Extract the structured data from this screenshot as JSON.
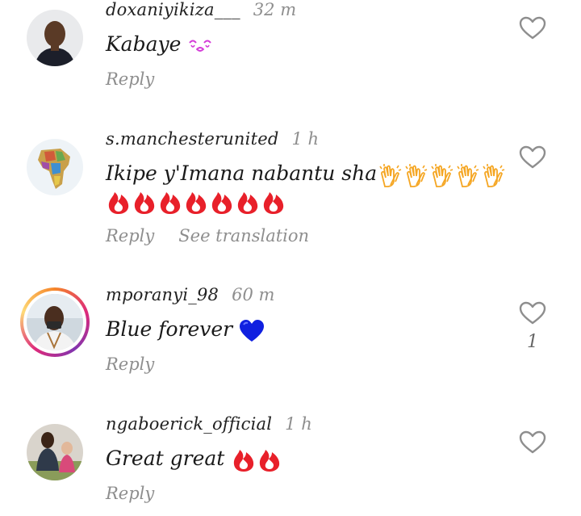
{
  "comments": [
    {
      "username": "doxaniyikiza___",
      "time": "32 m",
      "text": "Kabaye",
      "reply_label": "Reply",
      "emojis": [
        "kissing-face"
      ]
    },
    {
      "username": "s.manchesterunited",
      "time": "1 h",
      "text": "Ikipe y'Imana nabantu sha",
      "reply_label": "Reply",
      "translation_label": "See translation",
      "emojis": [
        "clapping-hands",
        "clapping-hands",
        "clapping-hands",
        "clapping-hands",
        "clapping-hands",
        "fire",
        "fire",
        "fire",
        "fire",
        "fire",
        "fire",
        "fire"
      ]
    },
    {
      "username": "mporanyi_98",
      "time": "60 m",
      "text": "Blue forever",
      "reply_label": "Reply",
      "like_count": "1",
      "emojis": [
        "blue-heart"
      ]
    },
    {
      "username": "ngaboerick_official",
      "time": "1 h",
      "text": "Great great",
      "reply_label": "Reply",
      "emojis": [
        "fire",
        "fire"
      ]
    }
  ],
  "colors": {
    "username": "#222222",
    "muted": "#8e8e8e",
    "fire": "#e8202a",
    "blue_heart": "#1020e0",
    "clap": "#f5a623",
    "story_ring": "#dd2a7b"
  }
}
